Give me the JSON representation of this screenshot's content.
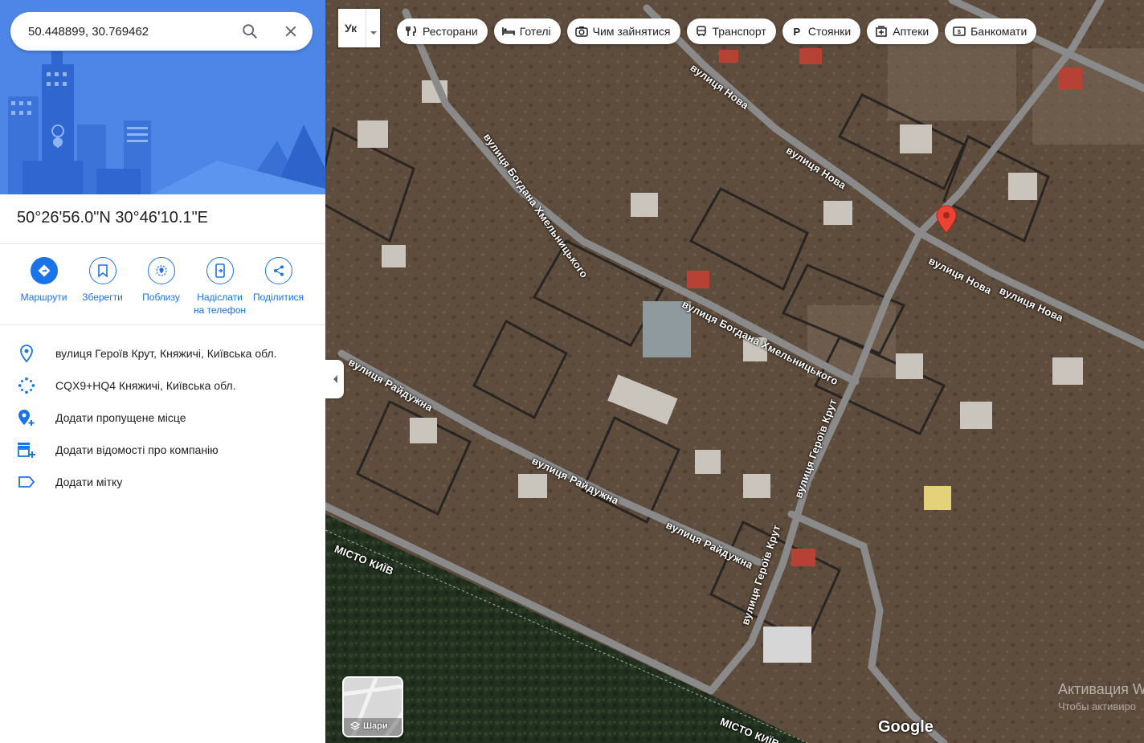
{
  "search": {
    "value": "50.448899, 30.769462"
  },
  "place": {
    "coordinates": "50°26'56.0\"N 30°46'10.1\"E"
  },
  "actions": [
    {
      "label": "Маршрути"
    },
    {
      "label": "Зберегти"
    },
    {
      "label": "Поблизу"
    },
    {
      "label": "Надіслати на телефон"
    },
    {
      "label": "Поділитися"
    }
  ],
  "info": {
    "address": "вулиця Героїв Крут, Княжичі, Київська обл.",
    "pluscode": "CQX9+HQ4 Княжичі, Київська обл.",
    "add_missing_place": "Додати пропущене місце",
    "add_business": "Додати відомості про компанію",
    "add_label": "Додати мітку"
  },
  "map": {
    "lang_button": "Ук",
    "chips": [
      "Ресторани",
      "Готелі",
      "Чим зайнятися",
      "Транспорт",
      "Стоянки",
      "Аптеки",
      "Банкомати"
    ],
    "streets": {
      "nova": "вулиця Нова",
      "khmelnytskoho": "вулиця Богдана Хмельницького",
      "raiduzhna": "вулиця Райдужна",
      "heroiv_krut": "вулиця Героїв Крут",
      "kyiv_city": "МІСТО КИЇВ"
    },
    "layers_label": "Шари",
    "google_logo": "Google",
    "watermark_line1": "Активация W",
    "watermark_line2": "Чтобы активиро"
  },
  "colors": {
    "accent": "#1a73e8",
    "pin": "#ea4335",
    "hero_bg": "#4e86e8"
  }
}
